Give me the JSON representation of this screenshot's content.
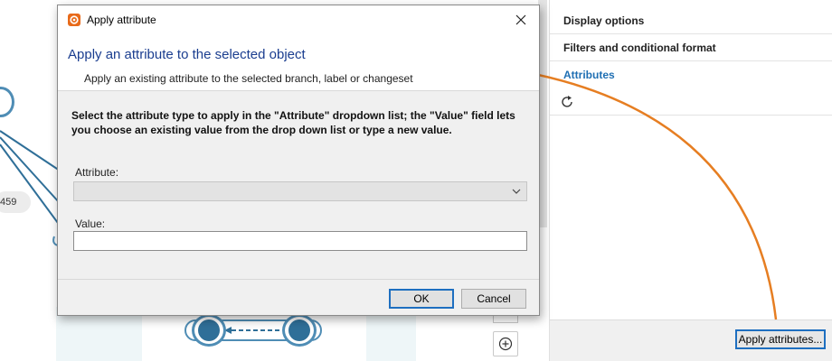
{
  "dialog": {
    "title": "Apply attribute",
    "heading": "Apply an attribute to the selected object",
    "subheading": "Apply an existing attribute to the selected branch, label or changeset",
    "instructions": "Select the attribute type to apply in the \"Attribute\" dropdown list; the \"Value\" field lets you choose an existing value from the drop down list or type a new value.",
    "attribute_label": "Attribute:",
    "attribute_value": "",
    "value_label": "Value:",
    "value_value": "",
    "ok_label": "OK",
    "cancel_label": "Cancel",
    "icons": {
      "app": "plastic-logo-icon",
      "close": "close-icon",
      "dropdown": "chevron-down-icon"
    }
  },
  "right_panel": {
    "sections": [
      {
        "label": "Display options"
      },
      {
        "label": "Filters and conditional format"
      },
      {
        "label": "Attributes"
      }
    ],
    "refresh_icon": "refresh-icon",
    "apply_button_label": "Apply attributes..."
  },
  "canvas": {
    "changeset_chip": "459",
    "zoom_in_icon": "zoom-in-icon"
  },
  "colors": {
    "accent": "#1e6fc0",
    "heading": "#1a3d8f",
    "active_section": "#1f6fb3",
    "arrow": "#e67e22",
    "node": "#2f6f98"
  }
}
